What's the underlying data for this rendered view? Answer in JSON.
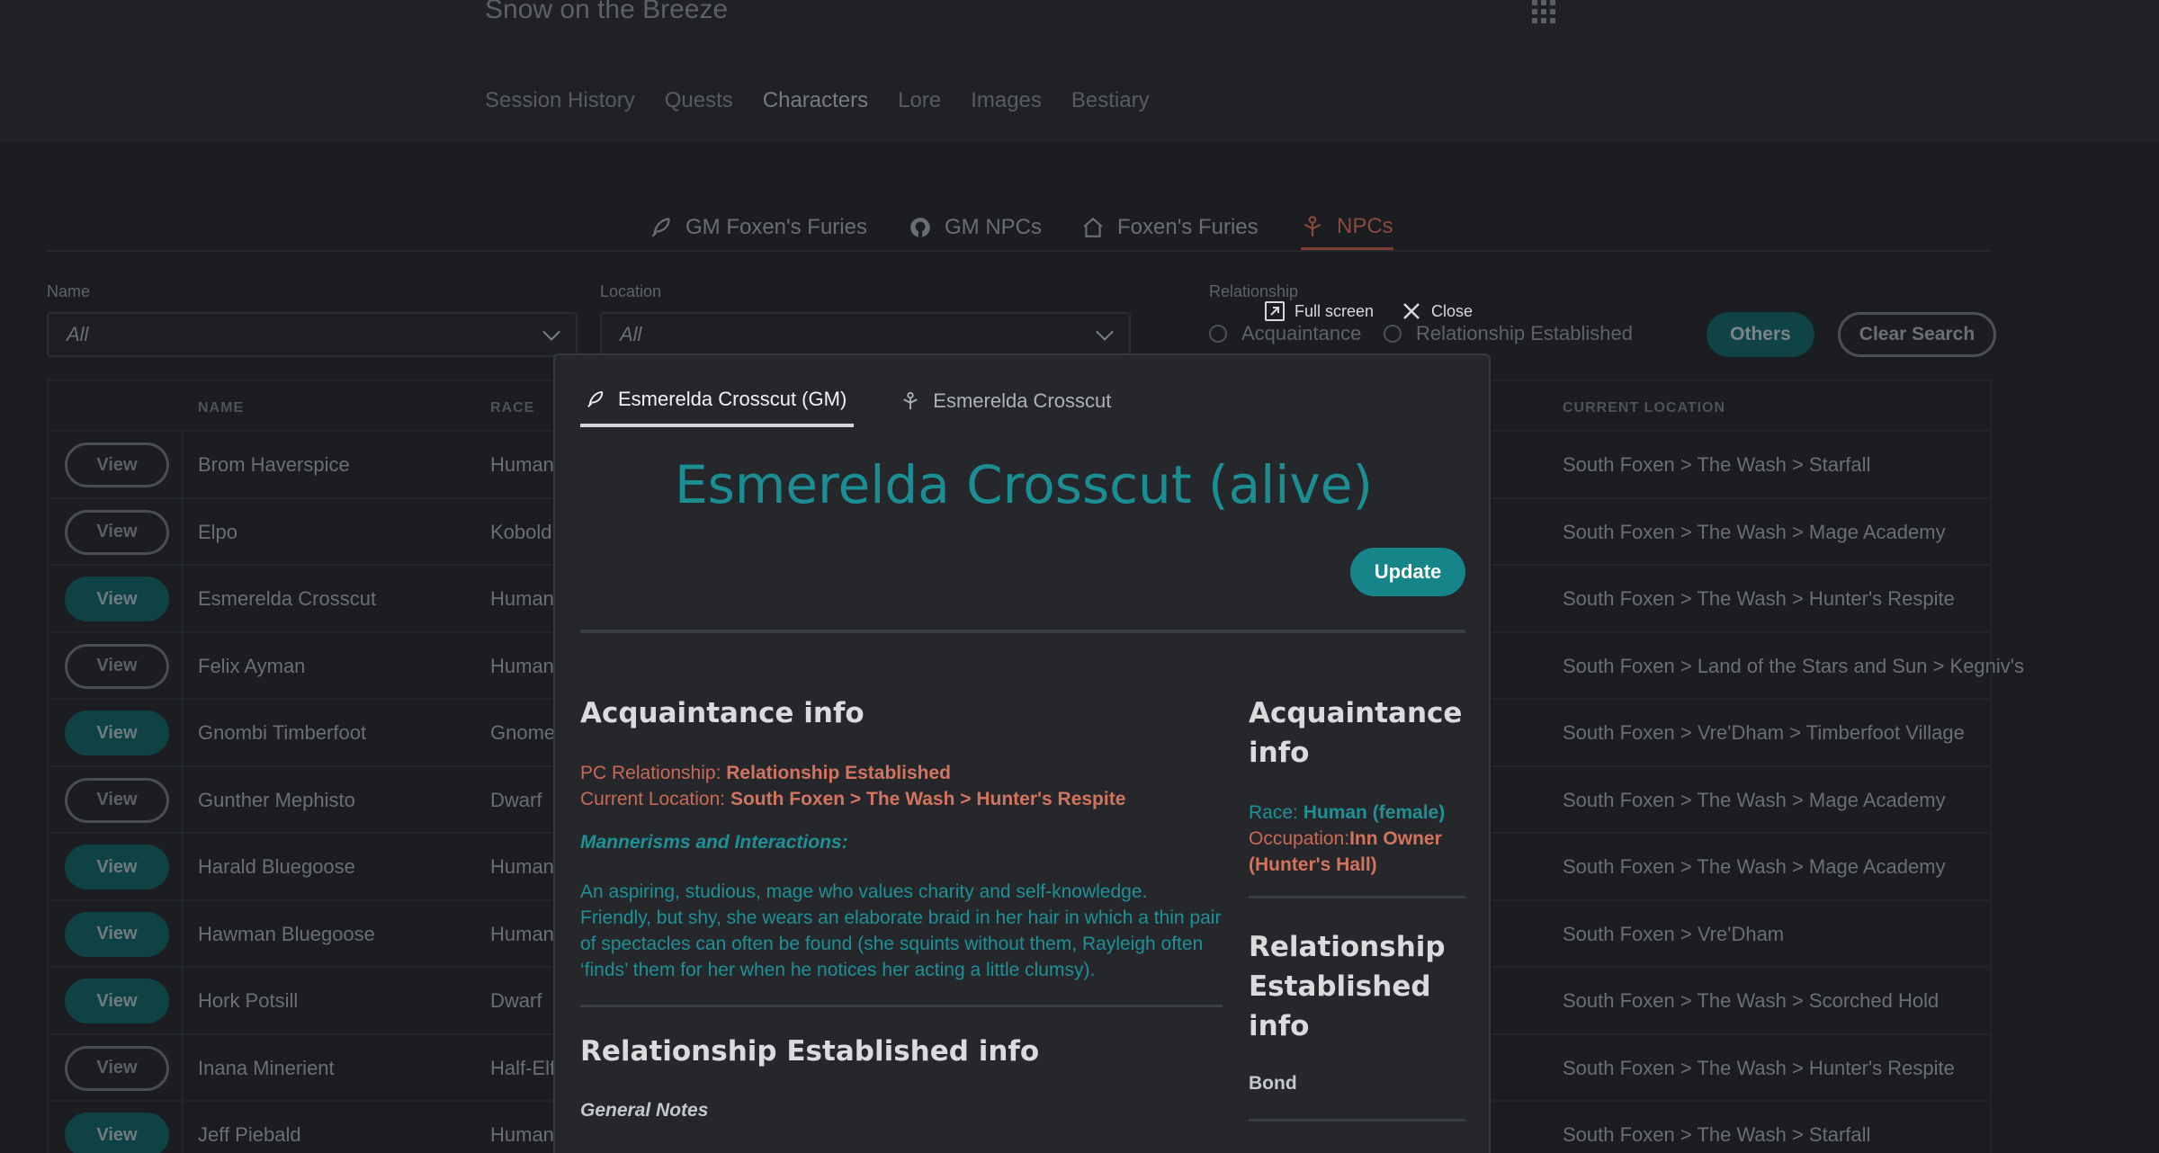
{
  "header": {
    "campaign_title": "Snow on the Breeze",
    "nav": [
      "Session History",
      "Quests",
      "Characters",
      "Lore",
      "Images",
      "Bestiary"
    ],
    "active_nav": "Characters"
  },
  "character_tabs": [
    {
      "label": "GM Foxen's Furies",
      "icon": "feather-icon"
    },
    {
      "label": "GM NPCs",
      "icon": "github-icon"
    },
    {
      "label": "Foxen's Furies",
      "icon": "home-icon"
    },
    {
      "label": "NPCs",
      "icon": "person-icon",
      "active": true
    }
  ],
  "filters": {
    "name_label": "Name",
    "name_value": "All",
    "location_label": "Location",
    "location_value": "All",
    "relationship_label": "Relationship",
    "radio_1": "Acquaintance",
    "radio_2": "Relationship Established",
    "others_button": "Others",
    "clear_button": "Clear Search"
  },
  "table": {
    "headers": {
      "name": "NAME",
      "race": "RACE",
      "location": "CURRENT LOCATION"
    },
    "rows": [
      {
        "action": "View",
        "name": "Brom Haverspice",
        "race": "Human",
        "location": "South Foxen > The Wash > Starfall"
      },
      {
        "action": "View",
        "name": "Elpo",
        "race": "Kobold",
        "location": "South Foxen > The Wash > Mage Academy"
      },
      {
        "action": "View",
        "name": "Esmerelda Crosscut",
        "race": "Human",
        "location": "South Foxen > The Wash > Hunter's Respite"
      },
      {
        "action": "View",
        "name": "Felix Ayman",
        "race": "Human",
        "location": "South Foxen > Land of the Stars and Sun > Kegniv's"
      },
      {
        "action": "View",
        "name": "Gnombi Timberfoot",
        "race": "Gnome",
        "location": "South Foxen > Vre'Dham > Timberfoot Village"
      },
      {
        "action": "View",
        "name": "Gunther Mephisto",
        "race": "Dwarf",
        "location": "South Foxen > The Wash > Mage Academy"
      },
      {
        "action": "View",
        "name": "Harald Bluegoose",
        "race": "Human",
        "location": "South Foxen > The Wash > Mage Academy"
      },
      {
        "action": "View",
        "name": "Hawman Bluegoose",
        "race": "Human",
        "location": "South Foxen > Vre'Dham"
      },
      {
        "action": "View",
        "name": "Hork Potsill",
        "race": "Dwarf",
        "location": "South Foxen > The Wash > Scorched Hold"
      },
      {
        "action": "View",
        "name": "Inana Minerient",
        "race": "Half-Elf",
        "location": "South Foxen > The Wash > Hunter's Respite"
      },
      {
        "action": "View",
        "name": "Jeff Piebald",
        "race": "Human",
        "location": "South Foxen > The Wash > Starfall"
      }
    ]
  },
  "modal": {
    "fullscreen_label": "Full screen",
    "close_label": "Close",
    "tab_gm": "Esmerelda Crosscut (GM)",
    "tab_player": "Esmerelda Crosscut",
    "title": "Esmerelda Crosscut (alive)",
    "update_button": "Update",
    "acq_heading": "Acquaintance info",
    "pc_rel_label": "PC Relationship:",
    "pc_rel_value": "Relationship Established",
    "cur_loc_label": "Current Location:",
    "cur_loc_value": "South Foxen > The Wash > Hunter's Respite",
    "mannerisms_label": "Mannerisms and Interactions:",
    "description": "An aspiring, studious, mage who values charity and self-knowledge. Friendly, but shy, she wears an elaborate braid in her hair in which a thin pair of spectacles can often be found (she squints without them, Rayleigh often ‘finds’ them for her when he notices her acting a little clumsy).",
    "rel_heading": "Relationship Established info",
    "general_notes": "General Notes",
    "side_acq_heading": "Acquaintance info",
    "race_label": "Race:",
    "race_value": "Human (female)",
    "occupation_label": "Occupation:",
    "occupation_value": "Inn Owner (Hunter's Hall)",
    "side_rel_heading": "Relationship Established info",
    "bond_label": "Bond"
  }
}
